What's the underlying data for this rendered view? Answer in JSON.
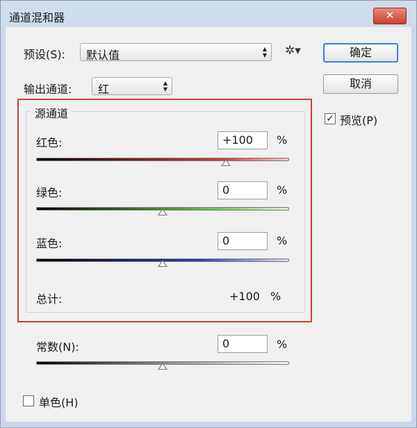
{
  "window": {
    "title": "通道混和器",
    "close_label": "✕"
  },
  "preset": {
    "label": "预设(S):",
    "value": "默认值"
  },
  "output": {
    "label": "输出通道:",
    "value": "红"
  },
  "buttons": {
    "ok": "确定",
    "cancel": "取消"
  },
  "preview": {
    "label": "预览(P)",
    "checked": true,
    "mark": "✓"
  },
  "source_group": {
    "title": "源通道",
    "channels": [
      {
        "label": "红色:",
        "value": "+100",
        "unit": "%",
        "slider_fraction": 0.75
      },
      {
        "label": "绿色:",
        "value": "0",
        "unit": "%",
        "slider_fraction": 0.5
      },
      {
        "label": "蓝色:",
        "value": "0",
        "unit": "%",
        "slider_fraction": 0.5
      }
    ],
    "total": {
      "label": "总计:",
      "value": "+100",
      "unit": "%"
    }
  },
  "constant": {
    "label": "常数(N):",
    "value": "0",
    "unit": "%",
    "slider_fraction": 0.5
  },
  "monochrome": {
    "label": "单色(H)",
    "checked": false
  },
  "colors": {
    "highlight_border": "#d43b33",
    "red_track": "#e23b3b",
    "green_track": "#6cc24a",
    "blue_track": "#2b3fb4"
  }
}
